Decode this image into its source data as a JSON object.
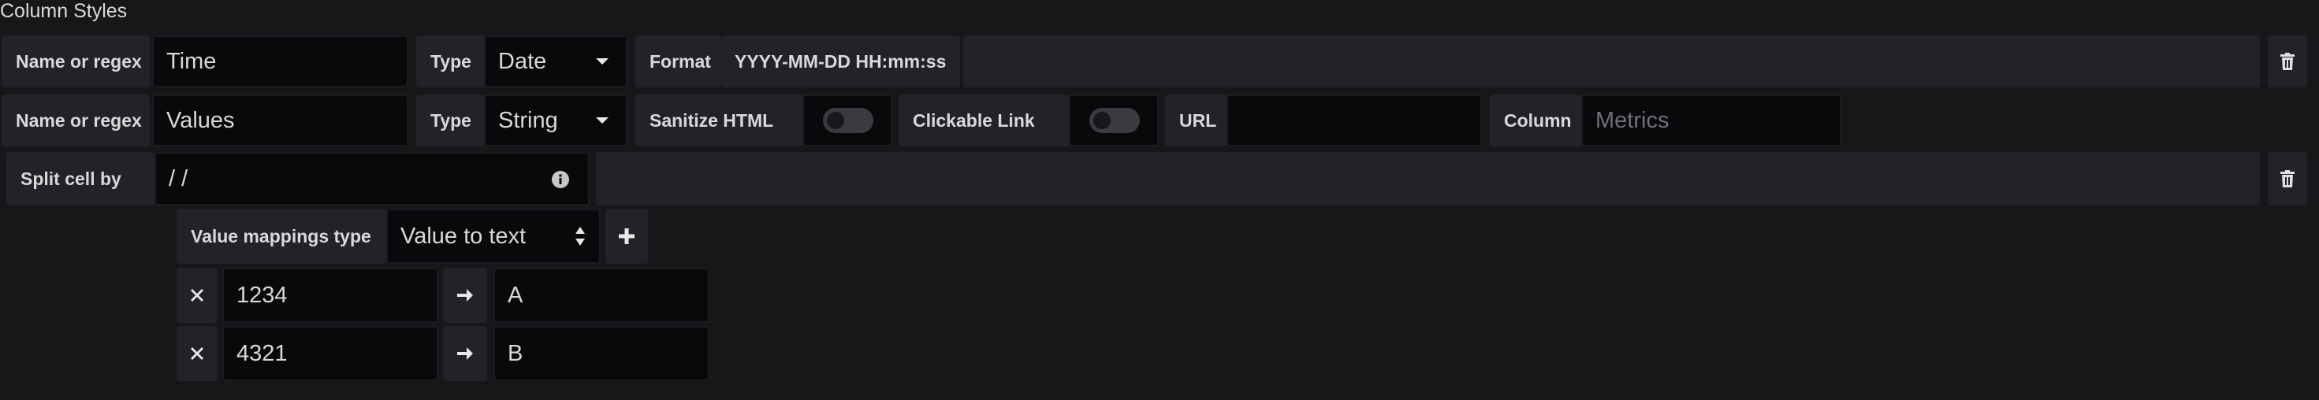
{
  "section": {
    "title": "Column Styles"
  },
  "row1": {
    "name_label": "Name or regex",
    "name_value": "Time",
    "type_label": "Type",
    "type_value": "Date",
    "format_label": "Format",
    "format_value": "YYYY-MM-DD HH:mm:ss"
  },
  "row2": {
    "name_label": "Name or regex",
    "name_value": "Values",
    "type_label": "Type",
    "type_value": "String",
    "sanitize_label": "Sanitize HTML",
    "clickable_label": "Clickable Link",
    "url_label": "URL",
    "url_value": "",
    "column_label": "Column",
    "column_placeholder": "Metrics"
  },
  "row3": {
    "split_label": "Split cell by",
    "split_value": "/ /"
  },
  "mappings": {
    "type_label": "Value mappings type",
    "type_value": "Value to text",
    "items": [
      {
        "value": "1234",
        "text": "A"
      },
      {
        "value": "4321",
        "text": "B"
      }
    ]
  },
  "colors": {
    "background": "#161719",
    "label_bg": "#222326",
    "input_bg": "#09090b",
    "text": "#d8d9da",
    "placeholder": "#6e7076"
  },
  "icons": [
    "trash-icon",
    "info-icon",
    "plus-icon",
    "remove-icon",
    "arrow-right-icon",
    "caret-down-icon"
  ]
}
